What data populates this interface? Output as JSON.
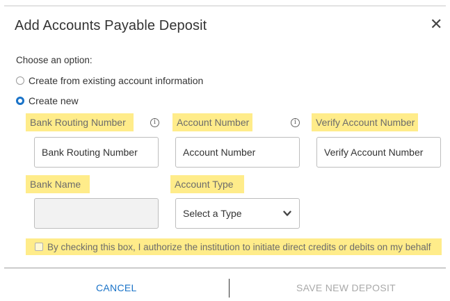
{
  "dialog": {
    "title": "Add Accounts Payable Deposit",
    "close_icon": "close-icon"
  },
  "options": {
    "prompt": "Choose an option:",
    "radios": [
      {
        "label": "Create from existing account information",
        "selected": false
      },
      {
        "label": "Create new",
        "selected": true
      }
    ]
  },
  "form": {
    "routing": {
      "label": "Bank Routing Number",
      "placeholder": "Bank Routing Number",
      "info_icon": "info-icon"
    },
    "account": {
      "label": "Account Number",
      "placeholder": "Account Number",
      "info_icon": "info-icon"
    },
    "verify": {
      "label": "Verify Account Number",
      "placeholder": "Verify Account Number"
    },
    "bank_name": {
      "label": "Bank Name",
      "value": ""
    },
    "account_type": {
      "label": "Account Type",
      "selected": "Select a Type",
      "icon": "chevron-down-icon"
    }
  },
  "consent": {
    "checked": false,
    "label": "By checking this box, I authorize the institution to initiate direct credits or debits on my behalf"
  },
  "footer": {
    "cancel_label": "CANCEL",
    "save_label": "SAVE NEW DEPOSIT"
  },
  "colors": {
    "accent": "#1a73c8",
    "highlight": "#ffec8a",
    "disabled_text": "#a9a9a9"
  }
}
